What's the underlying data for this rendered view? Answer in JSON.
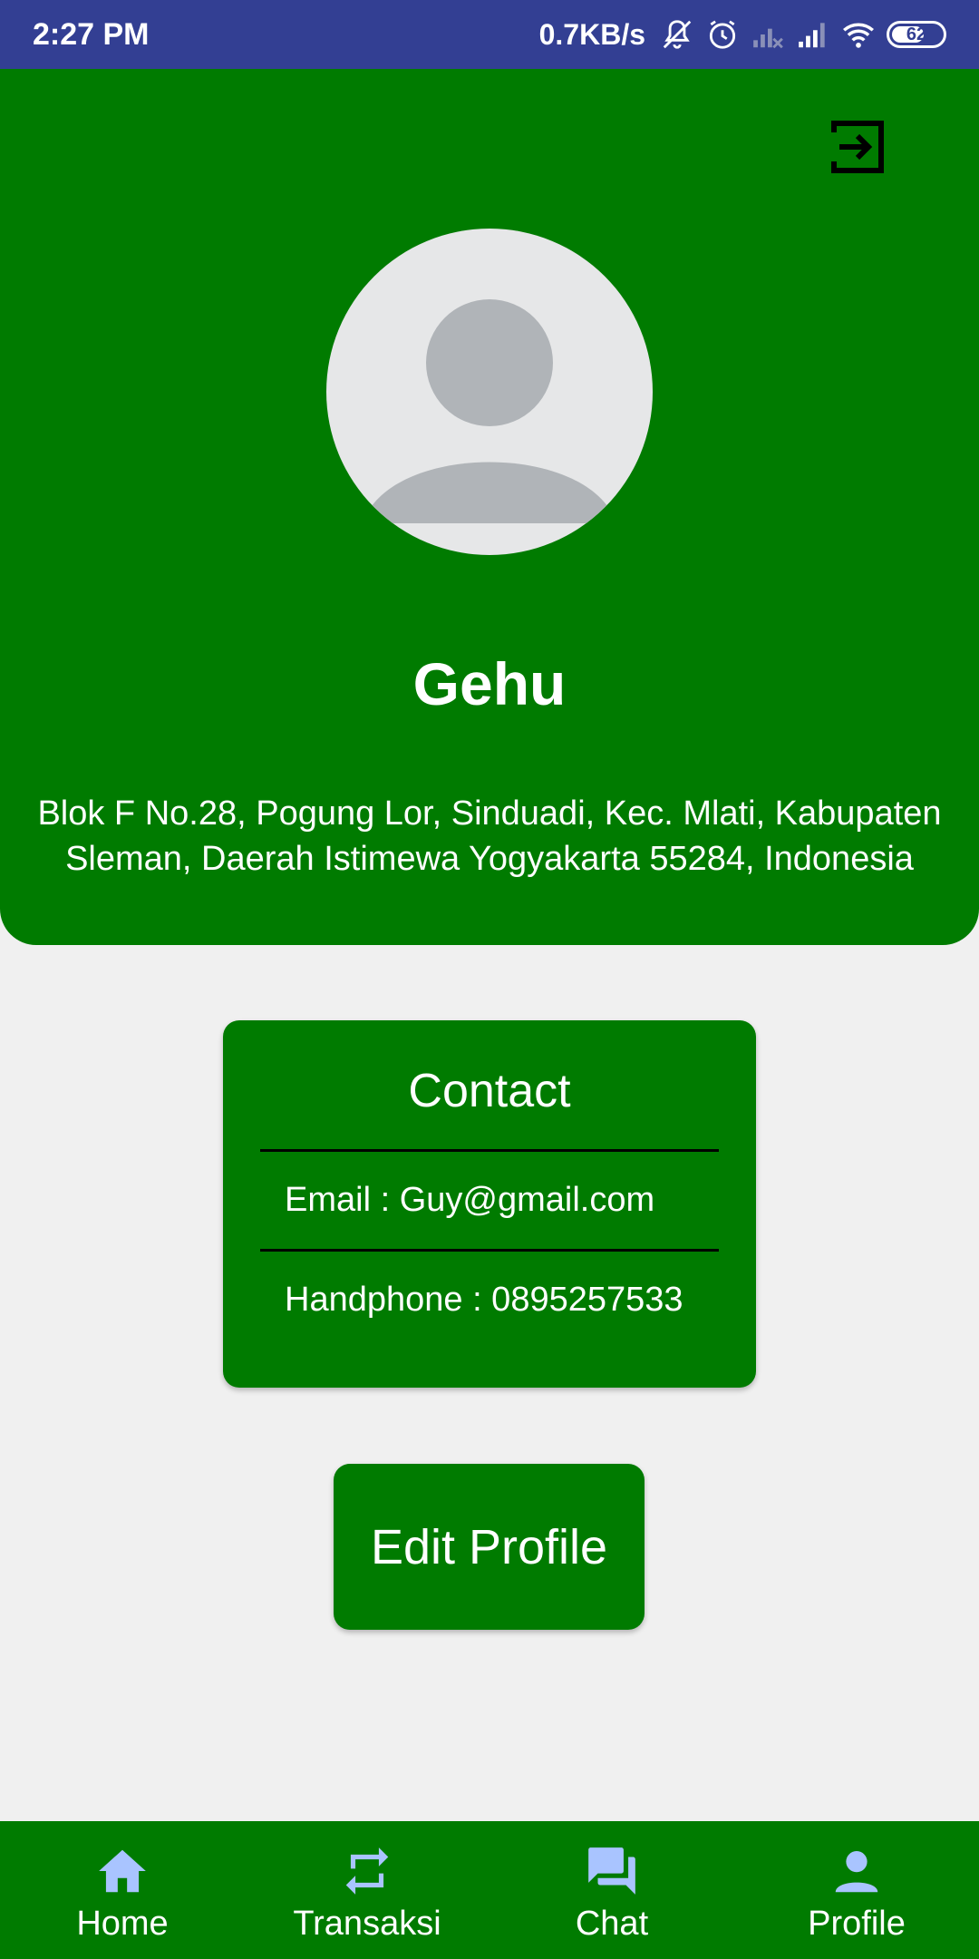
{
  "status_bar": {
    "time": "2:27 PM",
    "network_speed": "0.7KB/s",
    "battery_level": "62",
    "icons": [
      "mute-icon",
      "alarm-icon",
      "signal-no-sim-icon",
      "signal-icon",
      "wifi-icon",
      "battery-icon"
    ]
  },
  "header": {
    "name": "Gehu",
    "address": "Blok F No.28, Pogung Lor, Sinduadi, Kec. Mlati, Kabupaten Sleman, Daerah Istimewa Yogyakarta 55284, Indonesia",
    "logout_icon": "logout-icon",
    "avatar_icon": "default-avatar-icon"
  },
  "contact": {
    "title": "Contact",
    "email": "Email : Guy@gmail.com",
    "phone": "Handphone : 0895257533"
  },
  "edit_profile_label": "Edit Profile",
  "bottom_nav": {
    "items": [
      {
        "label": "Home",
        "icon": "home-icon"
      },
      {
        "label": "Transaksi",
        "icon": "repeat-icon"
      },
      {
        "label": "Chat",
        "icon": "chat-icon"
      },
      {
        "label": "Profile",
        "icon": "person-icon"
      }
    ]
  },
  "colors": {
    "status_bar": "#333f93",
    "primary_green": "#007b00",
    "background": "#f0f0f0",
    "nav_icon": "#a9c4ff",
    "avatar_bg": "#e6e7e8",
    "avatar_figure": "#b0b4b8"
  }
}
